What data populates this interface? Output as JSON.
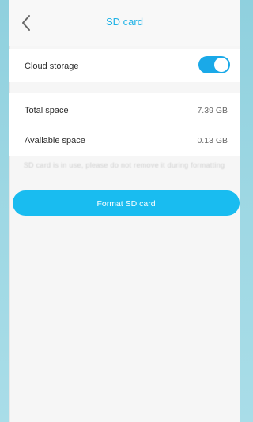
{
  "header": {
    "back_icon": "chevron-left-icon",
    "title": "SD card"
  },
  "cloud": {
    "label": "Cloud storage",
    "enabled": true,
    "accent": "#1aa9e8"
  },
  "storage": {
    "total_label": "Total space",
    "total_value": "7.39 GB",
    "available_label": "Available space",
    "available_value": "0.13 GB"
  },
  "hint_text": "SD card is in use, please do not remove it during formatting",
  "format_button": {
    "label": "Format SD card",
    "color": "#19bcf0"
  }
}
